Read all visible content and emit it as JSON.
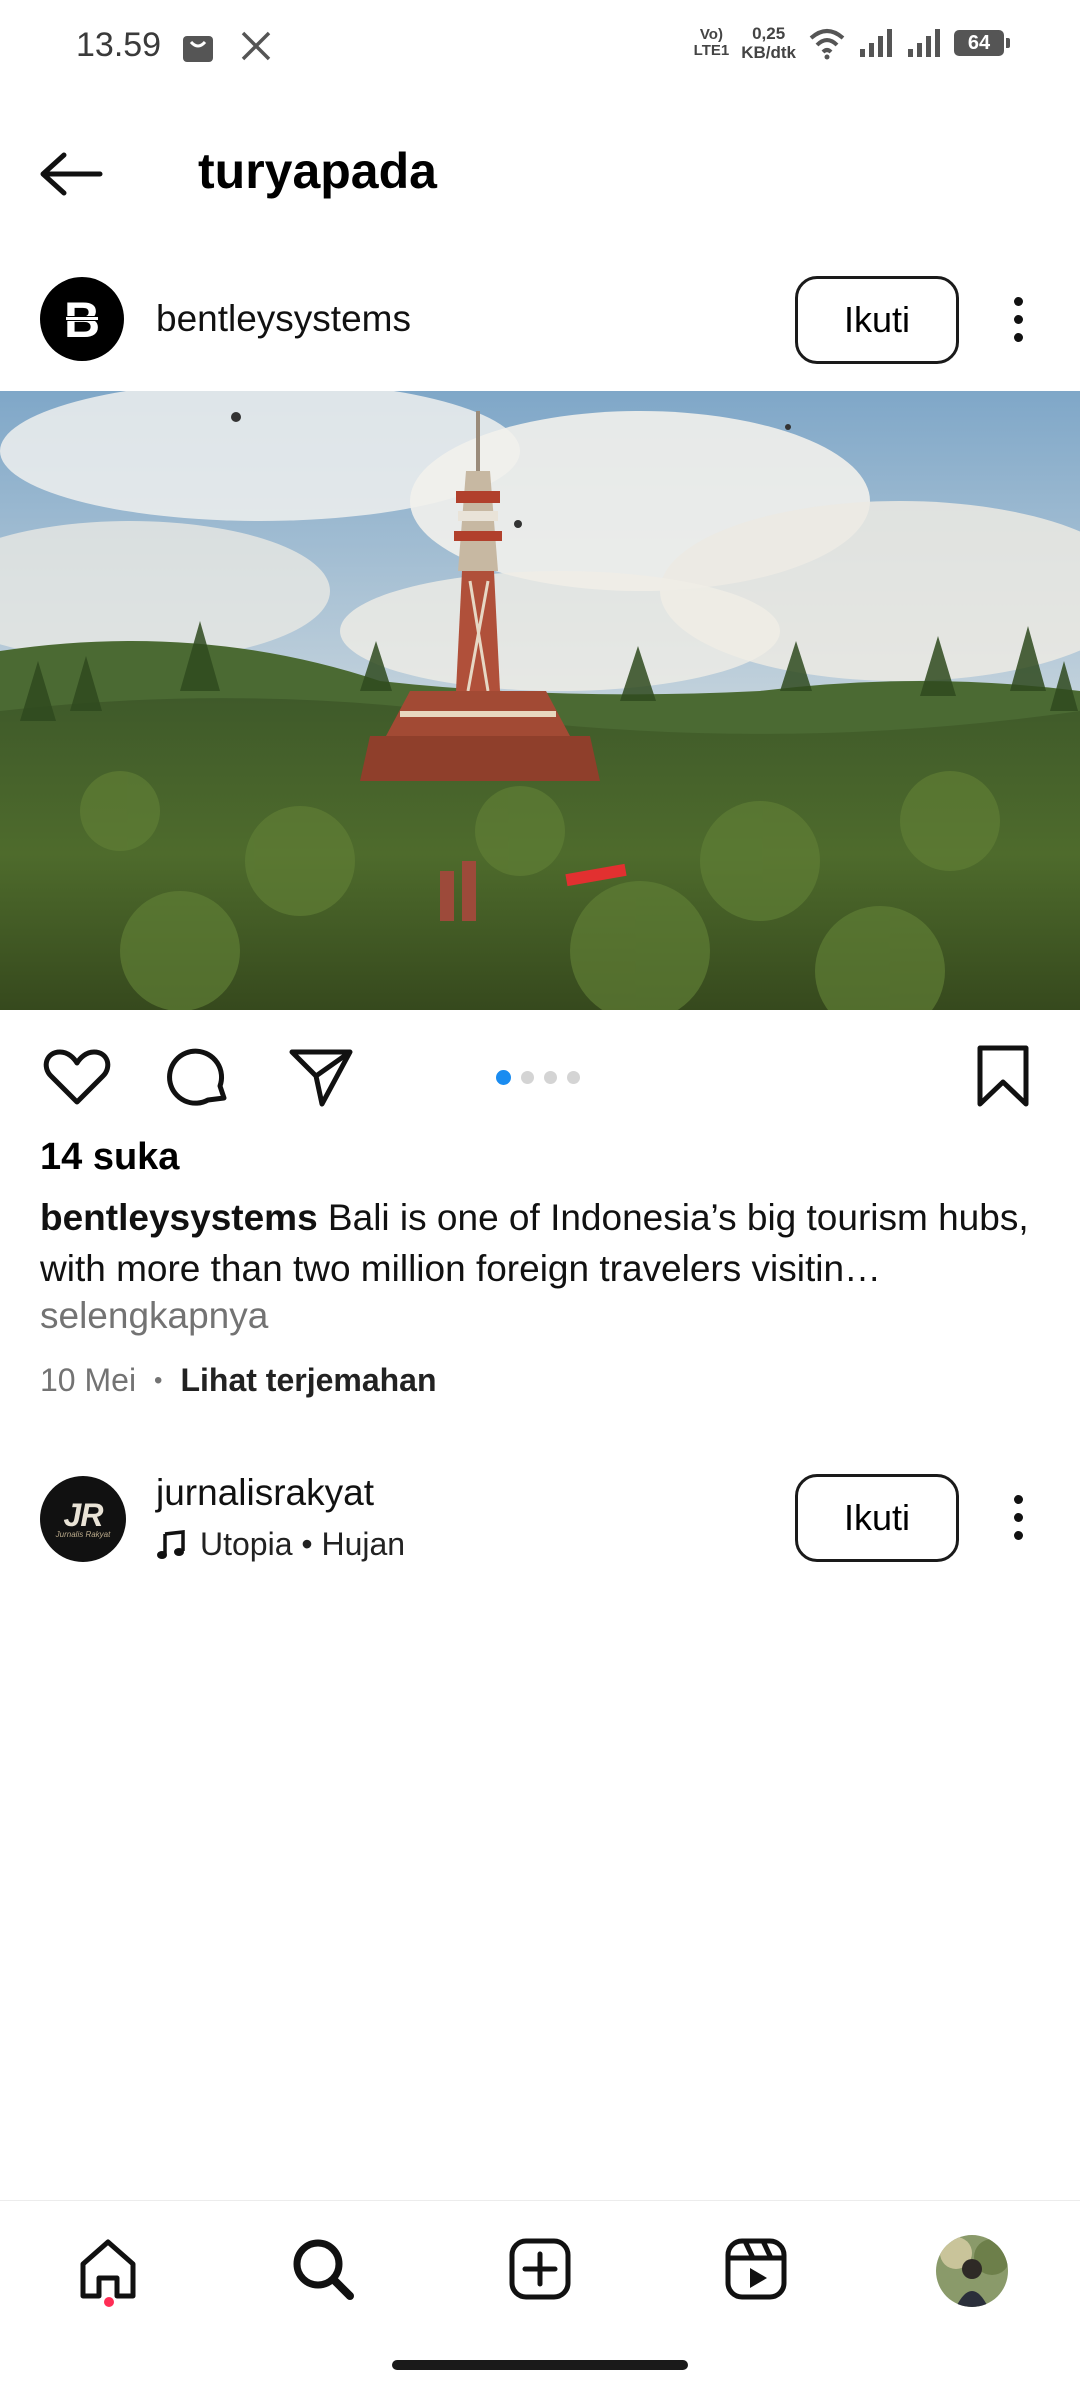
{
  "status_bar": {
    "time": "13.59",
    "volte_top": "Vo)",
    "volte_bottom": "LTE1",
    "net_speed_value": "0,25",
    "net_speed_unit": "KB/dtk",
    "battery": "64",
    "left_icons": [
      "shopping-bag-icon",
      "x-logo-icon"
    ],
    "right_icons": [
      "wifi-icon",
      "signal-icon",
      "signal-icon"
    ]
  },
  "header": {
    "title": "turyapada",
    "back_icon": "arrow-left-icon"
  },
  "post": {
    "username": "bentleysystems",
    "avatar_letter": "B",
    "follow_label": "Ikuti",
    "more_icon": "vertical-ellipsis-icon",
    "carousel_count": 4,
    "carousel_active_index": 0,
    "actions": [
      "heart-icon",
      "comment-icon",
      "share-icon",
      "bookmark-icon"
    ],
    "likes": "14 suka",
    "caption_user": "bentleysystems",
    "caption_text": " Bali is one of Indonesia’s big tourism hubs, with more than two million foreign travelers visitin…",
    "more_label": "selengkapnya",
    "date": "10 Mei",
    "separator": "•",
    "translate_label": "Lihat terjemahan"
  },
  "suggested_post": {
    "username": "jurnalisrakyat",
    "avatar_text": "JR",
    "avatar_subtext": "Jurnalis Rakyat",
    "music": "Utopia • Hujan",
    "music_icon": "music-note-icon",
    "follow_label": "Ikuti",
    "more_icon": "vertical-ellipsis-icon"
  },
  "bottom_nav": {
    "items": [
      "home-icon",
      "search-icon",
      "add-post-icon",
      "reels-icon",
      "profile-avatar"
    ],
    "active": "search-icon",
    "notification_dot_color": "#ff2d55"
  },
  "colors": {
    "carousel_active": "#1a8cf0",
    "secondary_text": "#737373"
  }
}
